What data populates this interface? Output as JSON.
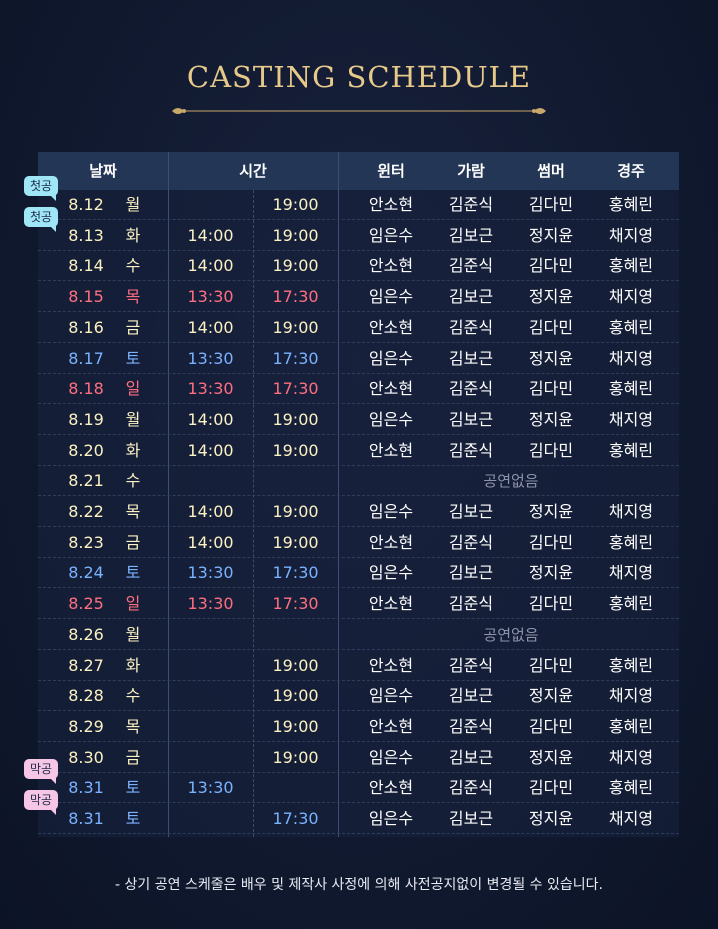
{
  "title": "CASTING SCHEDULE",
  "headers": {
    "date": "날짜",
    "time": "시간",
    "winter": "윈터",
    "garam": "가람",
    "summer": "썸머",
    "gyeongju": "경주"
  },
  "badges": {
    "first": "첫공",
    "last": "막공"
  },
  "rows": [
    {
      "date": "8.12",
      "day": "월",
      "t1": "",
      "t2": "19:00",
      "cast": [
        "안소현",
        "김준식",
        "김다민",
        "홍혜린"
      ],
      "style": "normal",
      "badge": "first"
    },
    {
      "date": "8.13",
      "day": "화",
      "t1": "14:00",
      "t2": "19:00",
      "cast": [
        "임은수",
        "김보근",
        "정지윤",
        "채지영"
      ],
      "style": "normal",
      "badge": "first"
    },
    {
      "date": "8.14",
      "day": "수",
      "t1": "14:00",
      "t2": "19:00",
      "cast": [
        "안소현",
        "김준식",
        "김다민",
        "홍혜린"
      ],
      "style": "normal",
      "badge": ""
    },
    {
      "date": "8.15",
      "day": "목",
      "t1": "13:30",
      "t2": "17:30",
      "cast": [
        "임은수",
        "김보근",
        "정지윤",
        "채지영"
      ],
      "style": "sun",
      "badge": ""
    },
    {
      "date": "8.16",
      "day": "금",
      "t1": "14:00",
      "t2": "19:00",
      "cast": [
        "안소현",
        "김준식",
        "김다민",
        "홍혜린"
      ],
      "style": "normal",
      "badge": ""
    },
    {
      "date": "8.17",
      "day": "토",
      "t1": "13:30",
      "t2": "17:30",
      "cast": [
        "임은수",
        "김보근",
        "정지윤",
        "채지영"
      ],
      "style": "sat",
      "badge": ""
    },
    {
      "date": "8.18",
      "day": "일",
      "t1": "13:30",
      "t2": "17:30",
      "cast": [
        "안소현",
        "김준식",
        "김다민",
        "홍혜린"
      ],
      "style": "sun",
      "badge": ""
    },
    {
      "date": "8.19",
      "day": "월",
      "t1": "14:00",
      "t2": "19:00",
      "cast": [
        "임은수",
        "김보근",
        "정지윤",
        "채지영"
      ],
      "style": "normal",
      "badge": ""
    },
    {
      "date": "8.20",
      "day": "화",
      "t1": "14:00",
      "t2": "19:00",
      "cast": [
        "안소현",
        "김준식",
        "김다민",
        "홍혜린"
      ],
      "style": "normal",
      "badge": ""
    },
    {
      "date": "8.21",
      "day": "수",
      "t1": "",
      "t2": "",
      "none": "공연없음",
      "style": "normal",
      "badge": ""
    },
    {
      "date": "8.22",
      "day": "목",
      "t1": "14:00",
      "t2": "19:00",
      "cast": [
        "임은수",
        "김보근",
        "정지윤",
        "채지영"
      ],
      "style": "normal",
      "badge": ""
    },
    {
      "date": "8.23",
      "day": "금",
      "t1": "14:00",
      "t2": "19:00",
      "cast": [
        "안소현",
        "김준식",
        "김다민",
        "홍혜린"
      ],
      "style": "normal",
      "badge": ""
    },
    {
      "date": "8.24",
      "day": "토",
      "t1": "13:30",
      "t2": "17:30",
      "cast": [
        "임은수",
        "김보근",
        "정지윤",
        "채지영"
      ],
      "style": "sat",
      "badge": ""
    },
    {
      "date": "8.25",
      "day": "일",
      "t1": "13:30",
      "t2": "17:30",
      "cast": [
        "안소현",
        "김준식",
        "김다민",
        "홍혜린"
      ],
      "style": "sun",
      "badge": ""
    },
    {
      "date": "8.26",
      "day": "월",
      "t1": "",
      "t2": "",
      "none": "공연없음",
      "style": "normal",
      "badge": ""
    },
    {
      "date": "8.27",
      "day": "화",
      "t1": "",
      "t2": "19:00",
      "cast": [
        "안소현",
        "김준식",
        "김다민",
        "홍혜린"
      ],
      "style": "normal",
      "badge": ""
    },
    {
      "date": "8.28",
      "day": "수",
      "t1": "",
      "t2": "19:00",
      "cast": [
        "임은수",
        "김보근",
        "정지윤",
        "채지영"
      ],
      "style": "normal",
      "badge": ""
    },
    {
      "date": "8.29",
      "day": "목",
      "t1": "",
      "t2": "19:00",
      "cast": [
        "안소현",
        "김준식",
        "김다민",
        "홍혜린"
      ],
      "style": "normal",
      "badge": ""
    },
    {
      "date": "8.30",
      "day": "금",
      "t1": "",
      "t2": "19:00",
      "cast": [
        "임은수",
        "김보근",
        "정지윤",
        "채지영"
      ],
      "style": "normal",
      "badge": ""
    },
    {
      "date": "8.31",
      "day": "토",
      "t1": "13:30",
      "t2": "",
      "cast": [
        "안소현",
        "김준식",
        "김다민",
        "홍혜린"
      ],
      "style": "sat",
      "badge": "last"
    },
    {
      "date": "8.31",
      "day": "토",
      "t1": "",
      "t2": "17:30",
      "cast": [
        "임은수",
        "김보근",
        "정지윤",
        "채지영"
      ],
      "style": "sat",
      "badge": "last"
    }
  ],
  "note": "-  상기 공연 스케줄은 배우 및 제작사 사정에 의해 사전공지없이 변경될 수 있습니다.",
  "colors": {
    "title_gold": "#e7c98a",
    "date_text": "#fbf1c2",
    "saturday": "#7ab2ff",
    "sunday": "#ff6e80",
    "header_bg": "#243655",
    "first_badge": "#9fe6f7",
    "last_badge": "#f7c6e6"
  }
}
